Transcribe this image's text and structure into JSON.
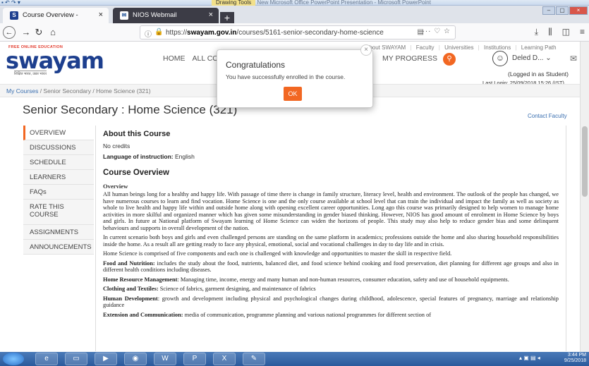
{
  "office": {
    "quick_access": "▪ ↶ ↷ ▾",
    "context_tab": "Drawing Tools",
    "title": "New Microsoft Office PowerPoint Presentation - Microsoft PowerPoint"
  },
  "browser": {
    "tabs": [
      {
        "label": "Course Overview -",
        "favicon": "S",
        "close": "×"
      },
      {
        "label": "NIOS Webmail",
        "favicon": "✉",
        "close": "×"
      }
    ],
    "new_tab": "+",
    "url_prefix": "https://",
    "url_domain": "swayam.gov.in",
    "url_path": "/courses/5161-senior-secondary-home-science",
    "window_controls": [
      "–",
      "▢",
      "×"
    ]
  },
  "site": {
    "logo_tag": "FREE ONLINE EDUCATION",
    "logo_word": "swayam",
    "logo_sub": "शिक्षित भारत, उन्नत भारत",
    "nav": [
      "HOME",
      "ALL COURS"
    ],
    "top_links": [
      "About SWAYAM",
      "|",
      "Faculty",
      "|",
      "Universities",
      "|",
      "Institutions",
      "|",
      "Learning Path"
    ],
    "my_progress": "MY PROGRESS",
    "username": "Deled D...",
    "logged_in_as": "(Logged in as Student)",
    "last_login": "Last Login: 25/09/2018 15:26 (IST)"
  },
  "breadcrumb": {
    "link": "My Courses",
    "rest": " / Senior Secondary / Home Science (321)"
  },
  "page_title": "Senior Secondary : Home Science (321)",
  "contact_faculty": "Contact Faculty",
  "course_nav": [
    "OVERVIEW",
    "DISCUSSIONS",
    "SCHEDULE",
    "LEARNERS",
    "FAQs",
    "RATE THIS COURSE",
    "ASSIGNMENTS",
    "ANNOUNCEMENTS"
  ],
  "content": {
    "about_heading": "About this Course",
    "credits": "No credits",
    "language_label": "Language of instruction:",
    "language_value": " English",
    "overview_heading": "Course Overview",
    "overview_subheading": "Overview",
    "p1": "All human beings long for a healthy and happy life. With passage of time there is change in family structure, literacy level, health and environment. The outlook of the people has changed, we have numerous courses to learn and find vocation. Home Science is one and the only course available at school level that can train the individual and impact the family as well as society as whole to live health and happy life within and outside home along with opening excellent career opportunities. Long ago this course was primarily designed to help women to manage home activities in more skilful and organized manner which has given some misunderstanding in gender biased thinking. However, NIOS has good amount of enrolment in Home Science by boys and girls. In future at National platform of Swayam learning of Home Science can widen the horizons of people. This study may also help to reduce gender bias and some delinquent behaviours and supports in overall development of the nation.",
    "p2": "In current scenario both boys and girls and even challenged persons are standing on the same platform in academics; professions outside the home and also sharing household responsibilities inside the home. As a result all are getting ready to face any physical, emotional, social and vocational challenges in day to day life and in crisis.",
    "p3": "Home Science is comprised of five components and each one is challenged with knowledge and opportunities to master the skill in respective field.",
    "food_label": "Food and Nutrition:",
    "food_text": " includes the study about the food, nutrients, balanced diet, and food science behind cooking and food preservation, diet planning for different age groups and also in different health conditions including diseases.",
    "hrm_label": "Home Resource Management",
    "hrm_text": ": Managing time, income, energy and many human and non-human resources, consumer education, safety and use of household equipments.",
    "clothing_label": "Clothing and Textiles:",
    "clothing_text": " Science of fabrics, garment designing, and maintenance of fabrics",
    "human_label": "Human Development",
    "human_text": ": growth and development including physical and psychological changes during childhood, adolescence, special features of pregnancy, marriage and relationship guidance",
    "ext_label": "Extension and Communication:",
    "ext_text": " media of communication, programme planning and various national programmes for different section of"
  },
  "modal": {
    "title": "Congratulations",
    "message": "You have successfully enrolled in the course.",
    "ok": "OK",
    "close": "×"
  },
  "taskbar": {
    "time": "3:44 PM",
    "date": "9/25/2018"
  }
}
